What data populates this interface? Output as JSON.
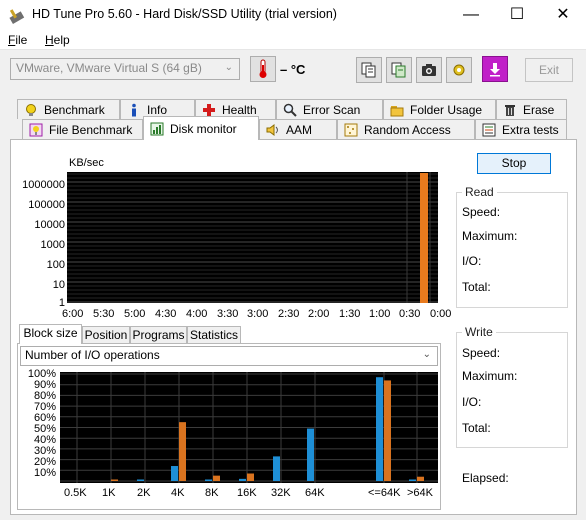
{
  "window": {
    "title": "HD Tune Pro 5.60 - Hard Disk/SSD Utility (trial version)",
    "controls": [
      "—",
      "☐",
      "✕"
    ]
  },
  "menu": [
    {
      "label": "File",
      "accel": "F",
      "rest": "ile"
    },
    {
      "label": "Help",
      "accel": "H",
      "rest": "elp"
    }
  ],
  "toolbar": {
    "drive": "VMware, VMware Virtual S (64 gB)",
    "temperature": "– °C",
    "exit_label": "Exit",
    "buttons": [
      "copy-info-icon",
      "copy-text-icon",
      "screenshot-icon",
      "options-icon",
      "download-icon"
    ]
  },
  "tabs_row1": [
    {
      "label": "Benchmark",
      "icon": "benchmark-icon"
    },
    {
      "label": "Info",
      "icon": "info-icon"
    },
    {
      "label": "Health",
      "icon": "health-icon"
    },
    {
      "label": "Error Scan",
      "icon": "error-scan-icon"
    },
    {
      "label": "Folder Usage",
      "icon": "folder-icon"
    },
    {
      "label": "Erase",
      "icon": "erase-icon"
    }
  ],
  "tabs_row2": [
    {
      "label": "File Benchmark",
      "icon": "file-benchmark-icon"
    },
    {
      "label": "Disk monitor",
      "icon": "disk-monitor-icon",
      "active": true
    },
    {
      "label": "AAM",
      "icon": "speaker-icon"
    },
    {
      "label": "Random Access",
      "icon": "random-access-icon"
    },
    {
      "label": "Extra tests",
      "icon": "extra-tests-icon"
    }
  ],
  "monitor": {
    "unit_label": "KB/sec",
    "y_ticks": [
      "1000000",
      "100000",
      "10000",
      "1000",
      "100",
      "10",
      "1"
    ],
    "x_ticks": [
      "6:00",
      "5:30",
      "5:00",
      "4:30",
      "4:00",
      "3:30",
      "3:00",
      "2:30",
      "2:00",
      "1:30",
      "1:00",
      "0:30",
      "0:00"
    ],
    "stop_label": "Stop",
    "activity_bar_color": "#e87a1e"
  },
  "read_group": {
    "title": "Read",
    "fields": [
      "Speed:",
      "Maximum:",
      "I/O:",
      "Total:"
    ]
  },
  "write_group": {
    "title": "Write",
    "fields": [
      "Speed:",
      "Maximum:",
      "I/O:",
      "Total:"
    ]
  },
  "elapsed_label": "Elapsed:",
  "inner_tabs": [
    {
      "label": "Block size",
      "active": true
    },
    {
      "label": "Position"
    },
    {
      "label": "Programs"
    },
    {
      "label": "Statistics"
    }
  ],
  "block_select": "Number of I/O operations",
  "chart_data": {
    "type": "bar",
    "categories": [
      "0.5K",
      "1K",
      "2K",
      "4K",
      "8K",
      "16K",
      "32K",
      "64K",
      "<=64K",
      ">64K"
    ],
    "y_ticks": [
      "100%",
      "90%",
      "80%",
      "70%",
      "60%",
      "50%",
      "40%",
      "30%",
      "20%",
      "10%"
    ],
    "ylim": [
      0,
      100
    ],
    "series": [
      {
        "color": "#1e8fd6",
        "values": [
          0,
          0,
          1,
          14,
          1,
          2,
          23,
          49,
          97,
          1
        ]
      },
      {
        "color": "#d9731f",
        "values": [
          0,
          1,
          0,
          55,
          5,
          7,
          0,
          0,
          94,
          4
        ]
      }
    ],
    "grid": true
  }
}
